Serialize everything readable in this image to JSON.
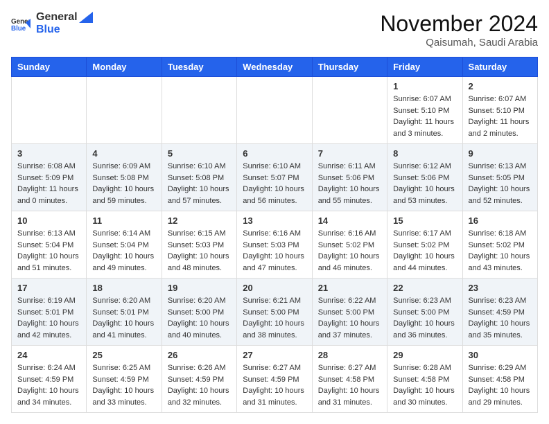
{
  "header": {
    "logo": {
      "general": "General",
      "blue": "Blue"
    },
    "title": "November 2024",
    "location": "Qaisumah, Saudi Arabia"
  },
  "calendar": {
    "weekdays": [
      "Sunday",
      "Monday",
      "Tuesday",
      "Wednesday",
      "Thursday",
      "Friday",
      "Saturday"
    ],
    "weeks": [
      [
        {
          "day": "",
          "content": ""
        },
        {
          "day": "",
          "content": ""
        },
        {
          "day": "",
          "content": ""
        },
        {
          "day": "",
          "content": ""
        },
        {
          "day": "",
          "content": ""
        },
        {
          "day": "1",
          "content": "Sunrise: 6:07 AM\nSunset: 5:10 PM\nDaylight: 11 hours and 3 minutes."
        },
        {
          "day": "2",
          "content": "Sunrise: 6:07 AM\nSunset: 5:10 PM\nDaylight: 11 hours and 2 minutes."
        }
      ],
      [
        {
          "day": "3",
          "content": "Sunrise: 6:08 AM\nSunset: 5:09 PM\nDaylight: 11 hours and 0 minutes."
        },
        {
          "day": "4",
          "content": "Sunrise: 6:09 AM\nSunset: 5:08 PM\nDaylight: 10 hours and 59 minutes."
        },
        {
          "day": "5",
          "content": "Sunrise: 6:10 AM\nSunset: 5:08 PM\nDaylight: 10 hours and 57 minutes."
        },
        {
          "day": "6",
          "content": "Sunrise: 6:10 AM\nSunset: 5:07 PM\nDaylight: 10 hours and 56 minutes."
        },
        {
          "day": "7",
          "content": "Sunrise: 6:11 AM\nSunset: 5:06 PM\nDaylight: 10 hours and 55 minutes."
        },
        {
          "day": "8",
          "content": "Sunrise: 6:12 AM\nSunset: 5:06 PM\nDaylight: 10 hours and 53 minutes."
        },
        {
          "day": "9",
          "content": "Sunrise: 6:13 AM\nSunset: 5:05 PM\nDaylight: 10 hours and 52 minutes."
        }
      ],
      [
        {
          "day": "10",
          "content": "Sunrise: 6:13 AM\nSunset: 5:04 PM\nDaylight: 10 hours and 51 minutes."
        },
        {
          "day": "11",
          "content": "Sunrise: 6:14 AM\nSunset: 5:04 PM\nDaylight: 10 hours and 49 minutes."
        },
        {
          "day": "12",
          "content": "Sunrise: 6:15 AM\nSunset: 5:03 PM\nDaylight: 10 hours and 48 minutes."
        },
        {
          "day": "13",
          "content": "Sunrise: 6:16 AM\nSunset: 5:03 PM\nDaylight: 10 hours and 47 minutes."
        },
        {
          "day": "14",
          "content": "Sunrise: 6:16 AM\nSunset: 5:02 PM\nDaylight: 10 hours and 46 minutes."
        },
        {
          "day": "15",
          "content": "Sunrise: 6:17 AM\nSunset: 5:02 PM\nDaylight: 10 hours and 44 minutes."
        },
        {
          "day": "16",
          "content": "Sunrise: 6:18 AM\nSunset: 5:02 PM\nDaylight: 10 hours and 43 minutes."
        }
      ],
      [
        {
          "day": "17",
          "content": "Sunrise: 6:19 AM\nSunset: 5:01 PM\nDaylight: 10 hours and 42 minutes."
        },
        {
          "day": "18",
          "content": "Sunrise: 6:20 AM\nSunset: 5:01 PM\nDaylight: 10 hours and 41 minutes."
        },
        {
          "day": "19",
          "content": "Sunrise: 6:20 AM\nSunset: 5:00 PM\nDaylight: 10 hours and 40 minutes."
        },
        {
          "day": "20",
          "content": "Sunrise: 6:21 AM\nSunset: 5:00 PM\nDaylight: 10 hours and 38 minutes."
        },
        {
          "day": "21",
          "content": "Sunrise: 6:22 AM\nSunset: 5:00 PM\nDaylight: 10 hours and 37 minutes."
        },
        {
          "day": "22",
          "content": "Sunrise: 6:23 AM\nSunset: 5:00 PM\nDaylight: 10 hours and 36 minutes."
        },
        {
          "day": "23",
          "content": "Sunrise: 6:23 AM\nSunset: 4:59 PM\nDaylight: 10 hours and 35 minutes."
        }
      ],
      [
        {
          "day": "24",
          "content": "Sunrise: 6:24 AM\nSunset: 4:59 PM\nDaylight: 10 hours and 34 minutes."
        },
        {
          "day": "25",
          "content": "Sunrise: 6:25 AM\nSunset: 4:59 PM\nDaylight: 10 hours and 33 minutes."
        },
        {
          "day": "26",
          "content": "Sunrise: 6:26 AM\nSunset: 4:59 PM\nDaylight: 10 hours and 32 minutes."
        },
        {
          "day": "27",
          "content": "Sunrise: 6:27 AM\nSunset: 4:59 PM\nDaylight: 10 hours and 31 minutes."
        },
        {
          "day": "28",
          "content": "Sunrise: 6:27 AM\nSunset: 4:58 PM\nDaylight: 10 hours and 31 minutes."
        },
        {
          "day": "29",
          "content": "Sunrise: 6:28 AM\nSunset: 4:58 PM\nDaylight: 10 hours and 30 minutes."
        },
        {
          "day": "30",
          "content": "Sunrise: 6:29 AM\nSunset: 4:58 PM\nDaylight: 10 hours and 29 minutes."
        }
      ]
    ]
  }
}
